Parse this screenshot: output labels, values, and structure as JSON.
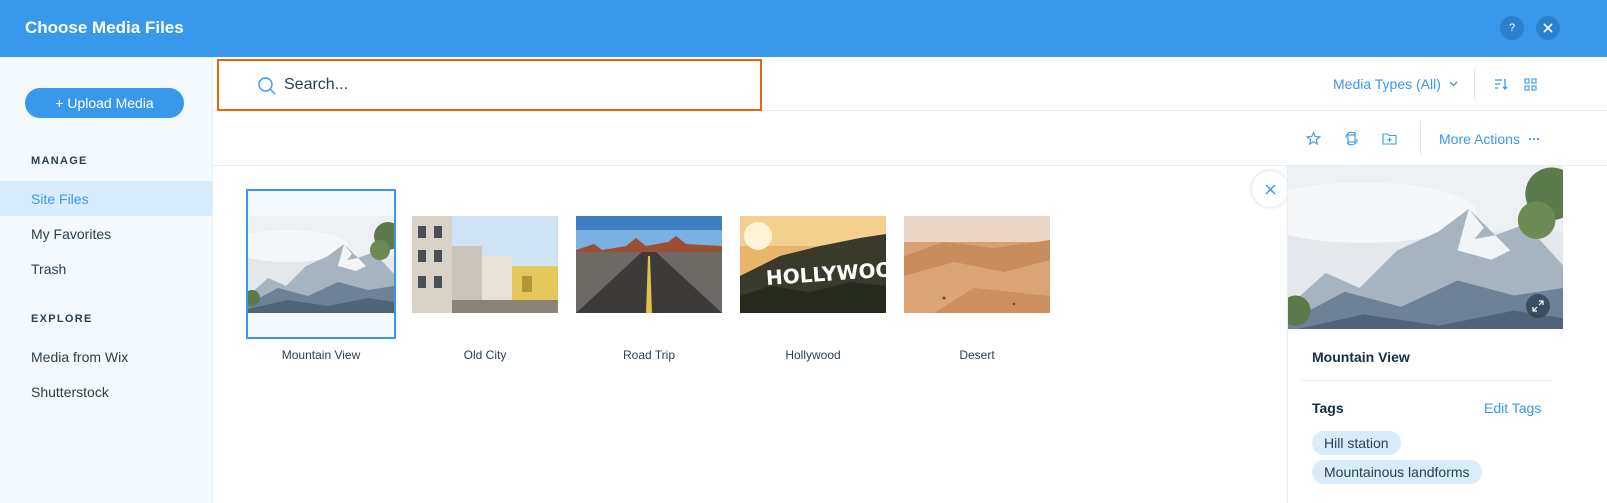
{
  "header": {
    "title": "Choose Media Files",
    "help_label": "?"
  },
  "sidebar": {
    "upload_label": "+ Upload Media",
    "manage_title": "MANAGE",
    "manage_items": [
      {
        "label": "Site Files",
        "active": true
      },
      {
        "label": "My Favorites",
        "active": false
      },
      {
        "label": "Trash",
        "active": false
      }
    ],
    "explore_title": "EXPLORE",
    "explore_items": [
      {
        "label": "Media from Wix"
      },
      {
        "label": "Shutterstock"
      }
    ]
  },
  "search": {
    "placeholder": "Search...",
    "value": ""
  },
  "toolbar": {
    "media_types_label": "Media Types (All)",
    "more_actions_label": "More Actions"
  },
  "media": [
    {
      "label": "Mountain View",
      "selected": true,
      "image": "mountain"
    },
    {
      "label": "Old City",
      "selected": false,
      "image": "old-city"
    },
    {
      "label": "Road Trip",
      "selected": false,
      "image": "road"
    },
    {
      "label": "Hollywood",
      "selected": false,
      "image": "hollywood"
    },
    {
      "label": "Desert",
      "selected": false,
      "image": "desert"
    }
  ],
  "details": {
    "title": "Mountain View",
    "tags_heading": "Tags",
    "edit_tags_label": "Edit Tags",
    "tags": [
      "Hill station",
      "Mountainous landforms"
    ],
    "hollywood_sign_text": "HOLLYWOOD"
  },
  "colors": {
    "accent": "#3899ec",
    "header_bg": "#3899ec",
    "sidebar_bg": "#f4f9fd",
    "active_item_bg": "#d9ecfc",
    "search_highlight": "#e8640e",
    "text_dark": "#162d3d"
  }
}
